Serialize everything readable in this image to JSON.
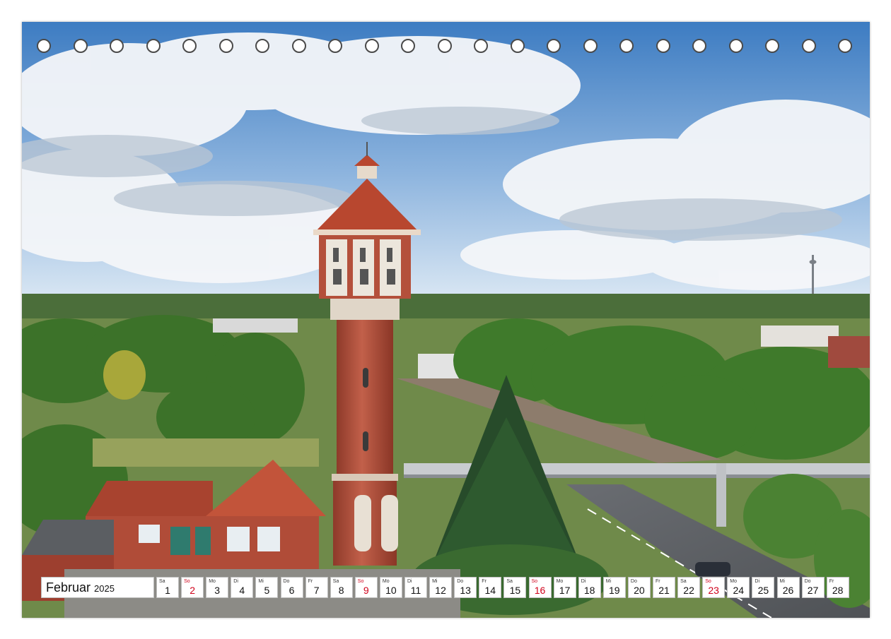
{
  "calendar": {
    "month": "Februar",
    "year": "2025",
    "days": [
      {
        "dow": "Sa",
        "num": "1",
        "sunday": false
      },
      {
        "dow": "So",
        "num": "2",
        "sunday": true
      },
      {
        "dow": "Mo",
        "num": "3",
        "sunday": false
      },
      {
        "dow": "Di",
        "num": "4",
        "sunday": false
      },
      {
        "dow": "Mi",
        "num": "5",
        "sunday": false
      },
      {
        "dow": "Do",
        "num": "6",
        "sunday": false
      },
      {
        "dow": "Fr",
        "num": "7",
        "sunday": false
      },
      {
        "dow": "Sa",
        "num": "8",
        "sunday": false
      },
      {
        "dow": "So",
        "num": "9",
        "sunday": true
      },
      {
        "dow": "Mo",
        "num": "10",
        "sunday": false
      },
      {
        "dow": "Di",
        "num": "11",
        "sunday": false
      },
      {
        "dow": "Mi",
        "num": "12",
        "sunday": false
      },
      {
        "dow": "Do",
        "num": "13",
        "sunday": false
      },
      {
        "dow": "Fr",
        "num": "14",
        "sunday": false
      },
      {
        "dow": "Sa",
        "num": "15",
        "sunday": false
      },
      {
        "dow": "So",
        "num": "16",
        "sunday": true
      },
      {
        "dow": "Mo",
        "num": "17",
        "sunday": false
      },
      {
        "dow": "Di",
        "num": "18",
        "sunday": false
      },
      {
        "dow": "Mi",
        "num": "19",
        "sunday": false
      },
      {
        "dow": "Do",
        "num": "20",
        "sunday": false
      },
      {
        "dow": "Fr",
        "num": "21",
        "sunday": false
      },
      {
        "dow": "Sa",
        "num": "22",
        "sunday": false
      },
      {
        "dow": "So",
        "num": "23",
        "sunday": true
      },
      {
        "dow": "Mo",
        "num": "24",
        "sunday": false
      },
      {
        "dow": "Di",
        "num": "25",
        "sunday": false
      },
      {
        "dow": "Mi",
        "num": "26",
        "sunday": false
      },
      {
        "dow": "Do",
        "num": "27",
        "sunday": false
      },
      {
        "dow": "Fr",
        "num": "28",
        "sunday": false
      }
    ]
  },
  "binding_hole_count": 23,
  "colors": {
    "sky_top": "#3f7fc4",
    "sky_bottom": "#cfe0f2",
    "brick": "#b5503a",
    "roof": "#b84a35",
    "foliage": "#3e7a2c",
    "sunday_red": "#d0021b"
  },
  "image_subject": "water-tower-landscape-photo"
}
